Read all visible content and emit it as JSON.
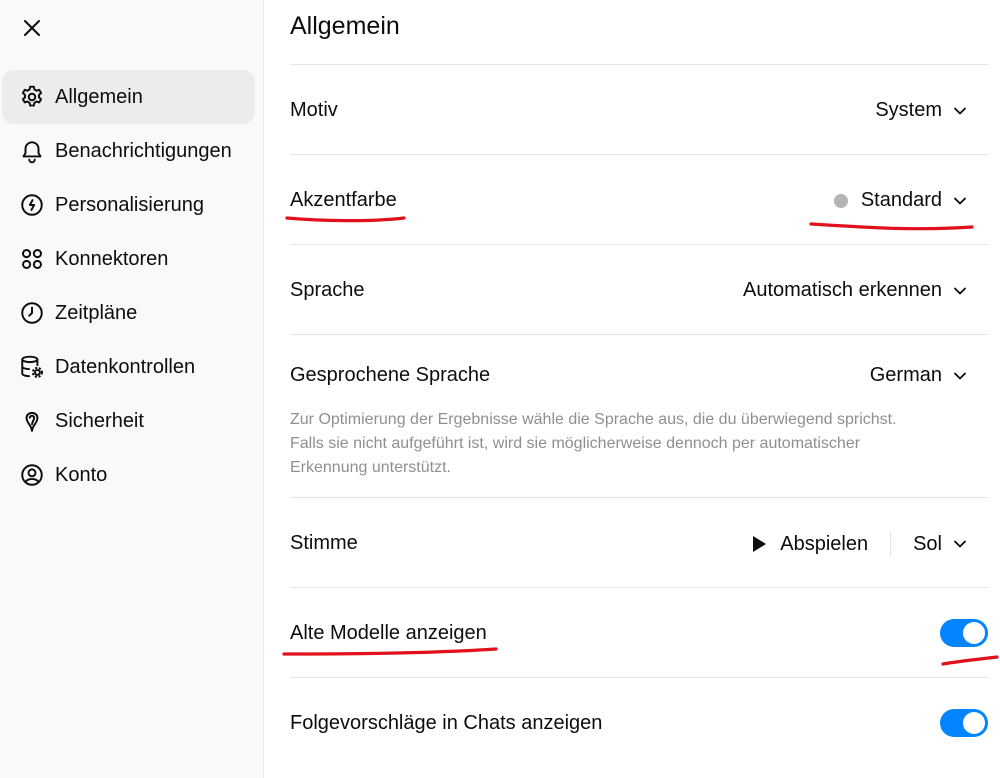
{
  "sidebar": {
    "items": [
      {
        "label": "Allgemein",
        "icon": "gear-icon",
        "active": true
      },
      {
        "label": "Benachrichtigungen",
        "icon": "bell-icon"
      },
      {
        "label": "Personalisierung",
        "icon": "personalization-icon"
      },
      {
        "label": "Konnektoren",
        "icon": "connectors-icon"
      },
      {
        "label": "Zeitpläne",
        "icon": "clock-icon"
      },
      {
        "label": "Datenkontrollen",
        "icon": "database-icon"
      },
      {
        "label": "Sicherheit",
        "icon": "shield-icon"
      },
      {
        "label": "Konto",
        "icon": "user-circle-icon"
      }
    ]
  },
  "main": {
    "title": "Allgemein",
    "theme": {
      "label": "Motiv",
      "value": "System"
    },
    "accent": {
      "label": "Akzentfarbe",
      "value": "Standard",
      "dot_color": "#b4b4b4"
    },
    "language": {
      "label": "Sprache",
      "value": "Automatisch erkennen"
    },
    "spoken_language": {
      "label": "Gesprochene Sprache",
      "value": "German",
      "description": "Zur Optimierung der Ergebnisse wähle die Sprache aus, die du überwiegend sprichst. Falls sie nicht aufgeführt ist, wird sie möglicherweise dennoch per automatischer Erkennung unterstützt."
    },
    "voice": {
      "label": "Stimme",
      "play_label": "Abspielen",
      "value": "Sol"
    },
    "legacy_models": {
      "label": "Alte Modelle anzeigen",
      "enabled": true
    },
    "follow_up": {
      "label": "Folgevorschläge in Chats anzeigen",
      "enabled": true
    }
  },
  "colors": {
    "toggle_on": "#0285ff",
    "annotation": "#e0101c"
  }
}
